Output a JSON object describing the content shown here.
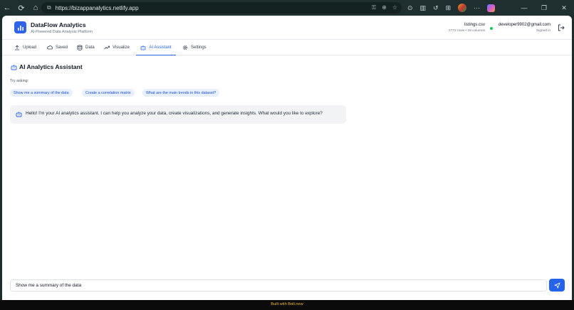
{
  "browser": {
    "url": "https://bizappanalytics.netlify.app"
  },
  "header": {
    "app_title": "DataFlow Analytics",
    "app_subtitle": "AI-Powered Data Analysis Platform",
    "file_name": "listings.csv",
    "file_meta": "2772 rows • 18 columns",
    "user_email": "developer9902@gmail.com",
    "user_status": "Signed in"
  },
  "tabs": [
    {
      "label": "Upload",
      "icon": "upload-icon"
    },
    {
      "label": "Saved",
      "icon": "cloud-icon"
    },
    {
      "label": "Data",
      "icon": "database-icon"
    },
    {
      "label": "Visualize",
      "icon": "trend-icon"
    },
    {
      "label": "AI Assistant",
      "icon": "bot-icon",
      "active": true
    },
    {
      "label": "Settings",
      "icon": "gear-icon"
    }
  ],
  "assistant": {
    "title": "AI Analytics Assistant",
    "try_label": "Try asking:",
    "suggestions": [
      "Show me a summary of the data",
      "Create a correlation matrix",
      "What are the main trends in this dataset?"
    ],
    "greeting": "Hello! I'm your AI analytics assistant. I can help you analyze your data, create visualizations, and generate insights. What would you like to explore?",
    "input_value": "Show me a summary of the data"
  },
  "footer": {
    "text": "Built with Bolt.new"
  },
  "colors": {
    "accent": "#2563eb",
    "chip_bg": "#e8f0fe",
    "footer_text": "#f0b429",
    "status_online": "#22c55e"
  }
}
